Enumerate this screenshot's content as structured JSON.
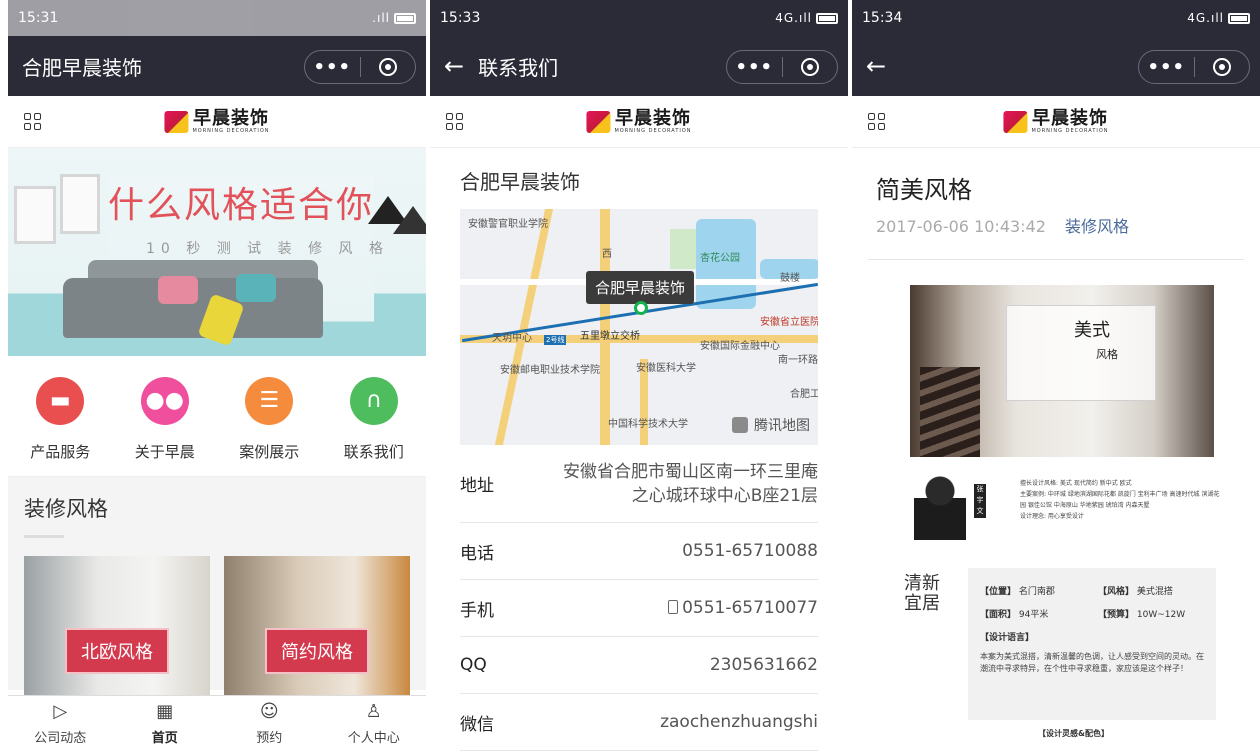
{
  "logo": {
    "cn": "早晨装饰",
    "en": "MORNING DECORATION"
  },
  "screen1": {
    "status_time": "15:31",
    "title": "合肥早晨装饰",
    "banner": {
      "title": "什么风格适合你",
      "subtitle": "10 秒 测 试 装 修 风 格"
    },
    "icons": [
      {
        "label": "产品服务",
        "icon": "chat-icon",
        "color": "#e94f4f"
      },
      {
        "label": "关于早晨",
        "icon": "group-icon",
        "color": "#ef4f9d"
      },
      {
        "label": "案例展示",
        "icon": "document-icon",
        "color": "#f58b3c"
      },
      {
        "label": "联系我们",
        "icon": "headset-icon",
        "color": "#4dbd5d"
      }
    ],
    "section_title": "装修风格",
    "cards": [
      {
        "label": "北欧风格"
      },
      {
        "label": "简约风格"
      }
    ],
    "tabs": [
      {
        "label": "公司动态",
        "icon": "news-icon"
      },
      {
        "label": "首页",
        "icon": "building-icon"
      },
      {
        "label": "预约",
        "icon": "face-icon"
      },
      {
        "label": "个人中心",
        "icon": "person-icon"
      }
    ]
  },
  "screen2": {
    "status_time": "15:33",
    "status_signal": "4G.ıll",
    "title": "联系我们",
    "company": "合肥早晨装饰",
    "map": {
      "pin_label": "合肥早晨装饰",
      "provider": "腾讯地图",
      "labels": [
        "安徽警官职业学院",
        "杏花公园",
        "鼓楼",
        "天玥中心",
        "五里墩立交桥",
        "安徽国际金融中心",
        "安徽省立医院",
        "安徽邮电职业技术学院",
        "安徽医科大学",
        "南一环路",
        "合肥工",
        "中国科学技术大学",
        "2号线",
        "西"
      ]
    },
    "rows": [
      {
        "key": "地址",
        "value": "安徽省合肥市蜀山区南一环三里庵之心城环球中心B座21层"
      },
      {
        "key": "电话",
        "value": "0551-65710088"
      },
      {
        "key": "手机",
        "value": "0551-65710077"
      },
      {
        "key": "QQ",
        "value": "2305631662"
      },
      {
        "key": "微信",
        "value": "zaochenzhuangshi"
      }
    ]
  },
  "screen3": {
    "status_time": "15:34",
    "article_title": "简美风格",
    "date": "2017-06-06 10:43:42",
    "category": "装修风格",
    "photo_title": "美式",
    "photo_sub": "风格",
    "designer_name": "张宇文",
    "designer_text": [
      "擅长设计风格: 美式 现代简约 新中式 欧式",
      "主要案例: 中环城 绿地滨湖国际花都 凯旋门 宝利丰广场 高速时代城 滨湖花园 银佳公馆 中海原山 华地紫园 琥珀湾 内森天墅",
      "设计理念: 用心享受设计"
    ],
    "side_title": "清新宜居",
    "spec": {
      "location_k": "【位置】",
      "location_v": "名门南郡",
      "style_k": "【风格】",
      "style_v": "美式混搭",
      "area_k": "【面积】",
      "area_v": "94平米",
      "budget_k": "【预算】",
      "budget_v": "10W~12W",
      "lang_k": "【设计语言】",
      "lang_v": "本案为美式混搭，清新温馨的色调，让人感受到空间的灵动。在潮流中寻求特异，在个性中寻求稳重，家应该是这个样子！"
    },
    "bottom_label": "【设计灵感&配色】"
  }
}
